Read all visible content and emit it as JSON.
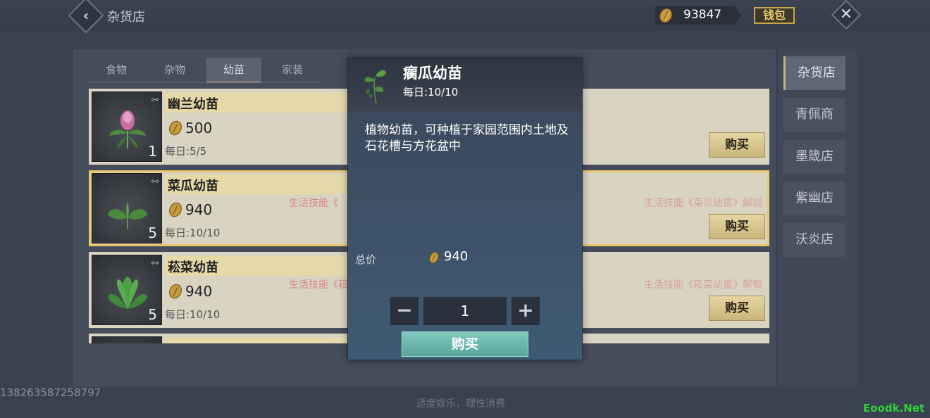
{
  "header": {
    "title": "杂货店",
    "gold": "93847",
    "wallet_label": "钱包"
  },
  "tabs": [
    {
      "label": "食物"
    },
    {
      "label": "杂物"
    },
    {
      "label": "幼苗"
    },
    {
      "label": "家装"
    }
  ],
  "items": [
    {
      "name": "幽兰幼苗",
      "price": "500",
      "daily": "每日:5/5",
      "qty": "1",
      "buy": "购买",
      "req_left": "",
      "req_right": ""
    },
    {
      "name": "菜瓜幼苗",
      "price": "940",
      "daily": "每日:10/10",
      "qty": "5",
      "buy": "购买",
      "req_left": "生活技能《",
      "req_right": "生活技能《菜瓜幼苗》解锁"
    },
    {
      "name": "菘菜幼苗",
      "price": "940",
      "daily": "每日:10/10",
      "qty": "5",
      "buy": "购买",
      "req_left": "生活技能《菘",
      "req_right": "生活技能《菘菜幼苗》解锁"
    }
  ],
  "sidebar": [
    {
      "label": "杂货店"
    },
    {
      "label": "青佩商店"
    },
    {
      "label": "墨箴店"
    },
    {
      "label": "紫幽店"
    },
    {
      "label": "沃炎店"
    }
  ],
  "popup": {
    "title": "瘸瓜幼苗",
    "daily": "每日:10/10",
    "description": "植物幼苗，可种植于家园范围内土地及石花槽与方花盆中",
    "total_label": "总价",
    "total_value": "940",
    "quantity": "1",
    "buy_label": "购买"
  },
  "footer": {
    "player_id": "138263587258797",
    "note": "适度娱乐，理性消费",
    "watermark": "Eoodk.Net"
  },
  "colors": {
    "accent_gold": "#e6c96b",
    "buy_button": "#58a59a",
    "background": "#3a4150"
  }
}
